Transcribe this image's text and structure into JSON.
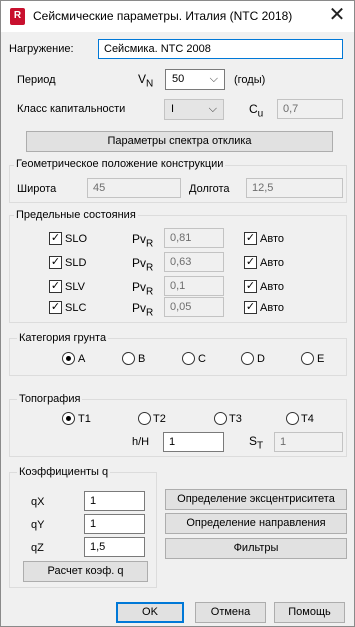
{
  "window": {
    "title": "Сейсмические параметры. Италия (NTC 2018)",
    "app_icon": "R",
    "close_glyph": "✕"
  },
  "load": {
    "label": "Нагружение:",
    "value": "Сейсмика. NTC 2008"
  },
  "period": {
    "label": "Период",
    "symbol": "V",
    "symbol_sub": "N",
    "value": "50",
    "unit": "(годы)"
  },
  "capacity": {
    "label": "Класс капитальности",
    "value": "I",
    "symbol": "C",
    "symbol_sub": "u",
    "cu_value": "0,7"
  },
  "spectrum_button": "Параметры спектра отклика",
  "geo": {
    "title": "Геометрическое положение конструкции",
    "lat_label": "Широта",
    "lat_value": "45",
    "lon_label": "Долгота",
    "lon_value": "12,5"
  },
  "limits": {
    "title": "Предельные состояния",
    "pvr_symbol": "Pv",
    "pvr_sub": "R",
    "auto_label": "Авто",
    "rows": [
      {
        "name": "SLO",
        "pvr": "0,81"
      },
      {
        "name": "SLD",
        "pvr": "0,63"
      },
      {
        "name": "SLV",
        "pvr": "0,1"
      },
      {
        "name": "SLC",
        "pvr": "0,05"
      }
    ]
  },
  "soil": {
    "title": "Категория грунта",
    "options": [
      "A",
      "B",
      "C",
      "D",
      "E"
    ],
    "selected": "A"
  },
  "topo": {
    "title": "Топография",
    "options": [
      "T1",
      "T2",
      "T3",
      "T4"
    ],
    "selected": "T1",
    "hh_label": "h/H",
    "hh_value": "1",
    "st_symbol": "S",
    "st_sub": "T",
    "st_value": "1"
  },
  "coef": {
    "title": "Коэффициенты q",
    "qx_label": "qX",
    "qx": "1",
    "qy_label": "qY",
    "qy": "1",
    "qz_label": "qZ",
    "qz": "1,5",
    "calc_button": "Расчет коэф. q"
  },
  "side_buttons": {
    "eccentricity": "Определение эксцентриситета",
    "direction": "Определение направления",
    "filters": "Фильтры"
  },
  "footer": {
    "ok": "OK",
    "cancel": "Отмена",
    "help": "Помощь"
  }
}
